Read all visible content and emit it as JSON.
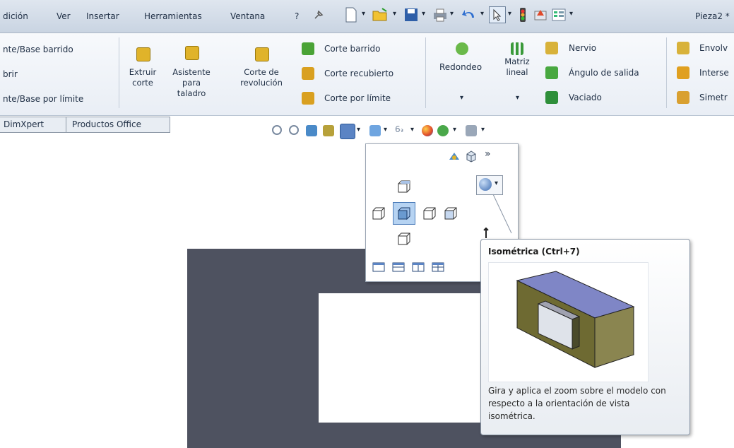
{
  "menubar": {
    "items": [
      "dición",
      "Ver",
      "Insertar",
      "Herramientas",
      "Ventana",
      "?"
    ],
    "document_title": "Pieza2 *"
  },
  "ribbon": {
    "left_items": [
      "nte/Base barrido",
      "brir",
      "nte/Base por límite"
    ],
    "extruir_corte": [
      "Extruir",
      "corte"
    ],
    "asistente": [
      "Asistente",
      "para",
      "taladro"
    ],
    "corte_revolucion": [
      "Corte de",
      "revolución"
    ],
    "corte_items": [
      "Corte barrido",
      "Corte recubierto",
      "Corte por límite"
    ],
    "redondeo": "Redondeo",
    "matriz": [
      "Matriz",
      "lineal"
    ],
    "features": [
      "Nervio",
      "Ángulo de salida",
      "Vaciado"
    ],
    "right_items": [
      "Envolv",
      "Interse",
      "Simetr"
    ]
  },
  "tabs": [
    "DimXpert",
    "Productos Office"
  ],
  "flyout": {
    "more_label": "»"
  },
  "tooltip": {
    "title": "Isométrica  (Ctrl+7)",
    "description": "Gira y aplica el zoom sobre el modelo con respecto a la orientación de vista isométrica."
  },
  "colors": {
    "accent": "#3a7bd5",
    "model_face": "#7a7a4a",
    "viewport_dark": "#4e5260"
  }
}
